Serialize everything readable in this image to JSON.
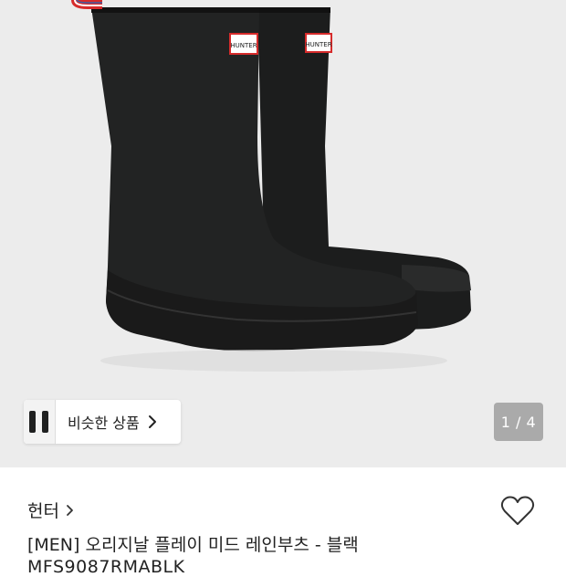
{
  "gallery": {
    "boot_logo_text": "HUNTER",
    "similar_label": "비슷한 상품",
    "counter": "1 / 4"
  },
  "product": {
    "brand": "헌터",
    "title": "[MEN] 오리지날 플레이 미드 레인부츠 - 블랙",
    "code": "MFS9087RMABLK"
  },
  "colors": {
    "boot": "#1f2020",
    "background": "#ececec",
    "accent": "#d62b2b"
  },
  "icons": {
    "chevron": "chevron-right-icon",
    "heart": "heart-outline-icon"
  }
}
